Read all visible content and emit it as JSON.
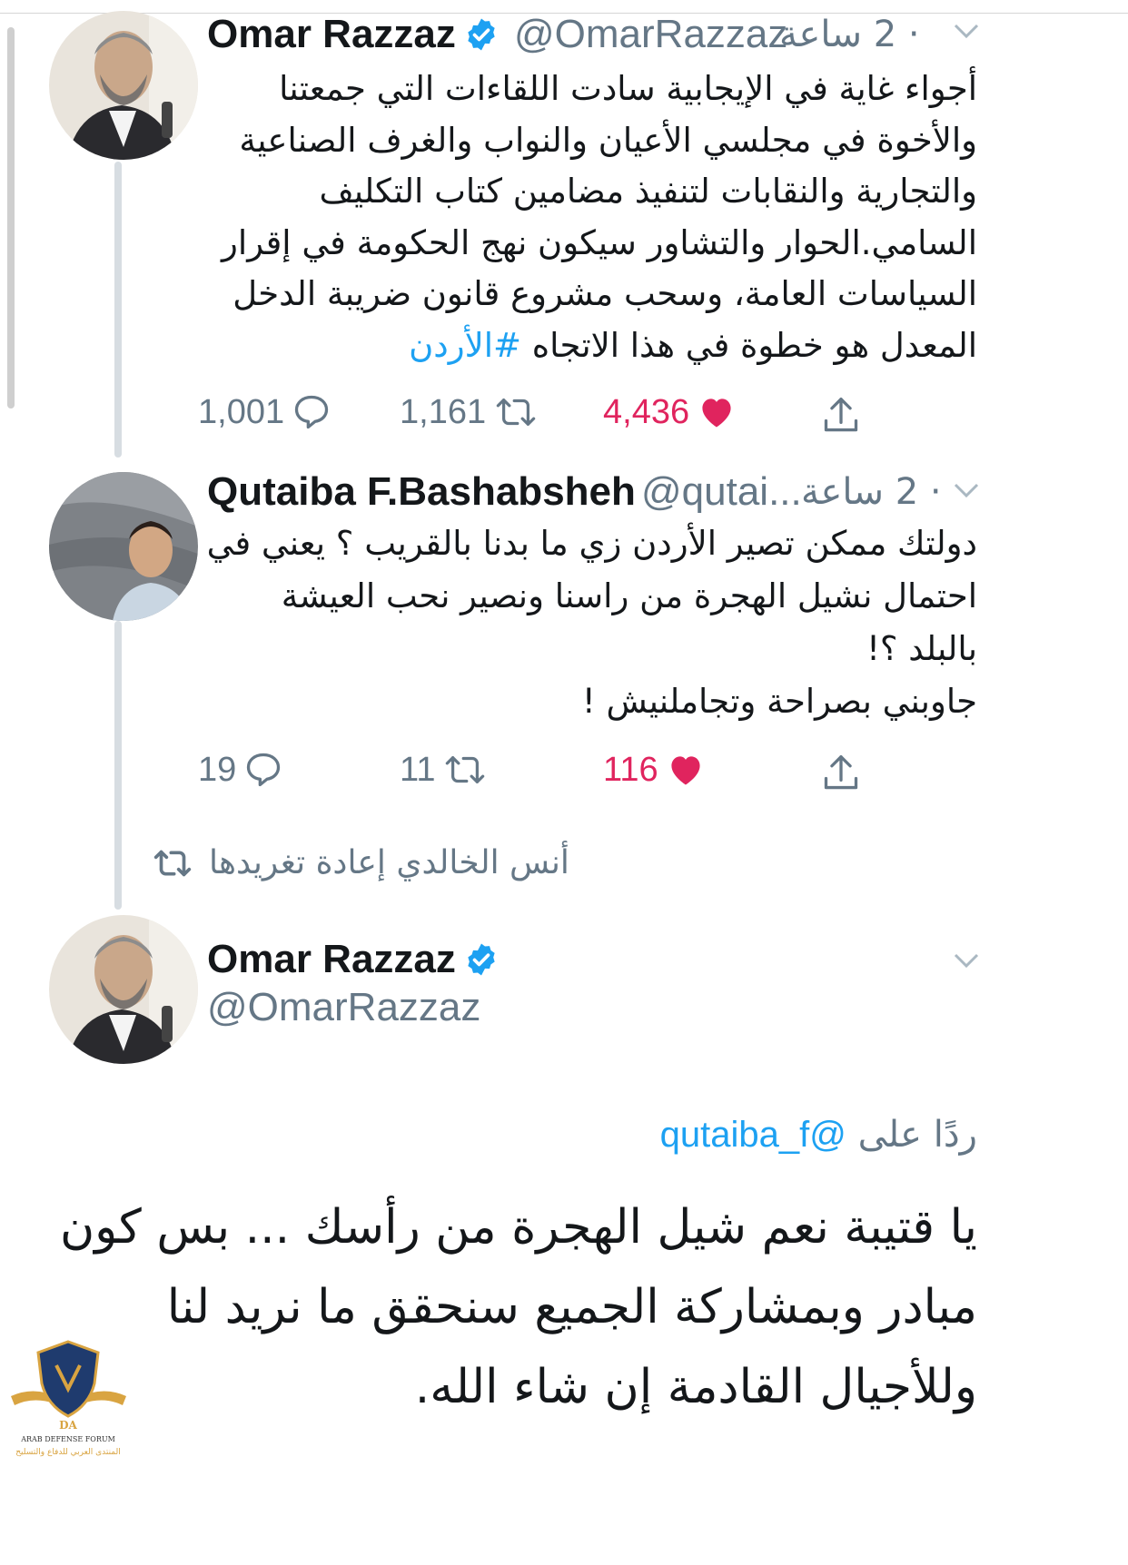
{
  "tweets": [
    {
      "name": "Omar Razzaz",
      "handle": "@OmarRazzaz",
      "time": "2 ساعة",
      "body": [
        "أجواء غاية في الإيجابية سادت اللقاءات التي جمعتنا",
        "والأخوة في مجلسي الأعيان والنواب والغرف الصناعية",
        "والتجارية والنقابات لتنفيذ مضامين كتاب التكليف",
        "السامي.الحوار والتشاور سيكون نهج الحكومة في إقرار",
        "السياسات العامة، وسحب مشروع قانون ضريبة الدخل",
        "المعدل هو خطوة في هذا الاتجاه"
      ],
      "hashtag": "#الأردن",
      "replies": "1,001",
      "retweets": "1,161",
      "likes": "4,436"
    },
    {
      "name": "Qutaiba F.Bashabsheh",
      "handle": "@qutai...",
      "time": "2 ساعة",
      "body": [
        "دولتك ممكن تصير الأردن زي ما بدنا بالقريب ؟ يعني في",
        "احتمال نشيل الهجرة من راسنا ونصير نحب العيشة",
        "بالبلد ؟!",
        "جاوبني بصراحة وتجاملنيش !"
      ],
      "replies": "19",
      "retweets": "11",
      "likes": "116"
    }
  ],
  "retweeted_by": "أنس  الخالدي إعادة تغريدها",
  "main_tweet": {
    "name": "Omar Razzaz",
    "handle": "@OmarRazzaz",
    "reply_prefix": "ردًا على",
    "reply_to": "@qutaiba_f",
    "body": [
      "يا قتيبة  نعم شيل الهجرة من رأسك ... بس كون",
      "مبادر  وبمشاركة الجميع سنحقق ما نريد لنا",
      "وللأجيال القادمة إن شاء الله."
    ]
  },
  "watermark": {
    "monogram": "DA",
    "name_en": "ARAB DEFENSE FORUM",
    "name_ar": "المنتدى العربي للدفاع والتسليح"
  },
  "colors": {
    "link": "#1da1f2",
    "like": "#e0245e",
    "muted": "#657786",
    "text": "#14171a"
  },
  "icons": [
    "reply-icon",
    "retweet-icon",
    "heart-icon",
    "share-icon",
    "verified-icon",
    "chevron-down-icon"
  ]
}
